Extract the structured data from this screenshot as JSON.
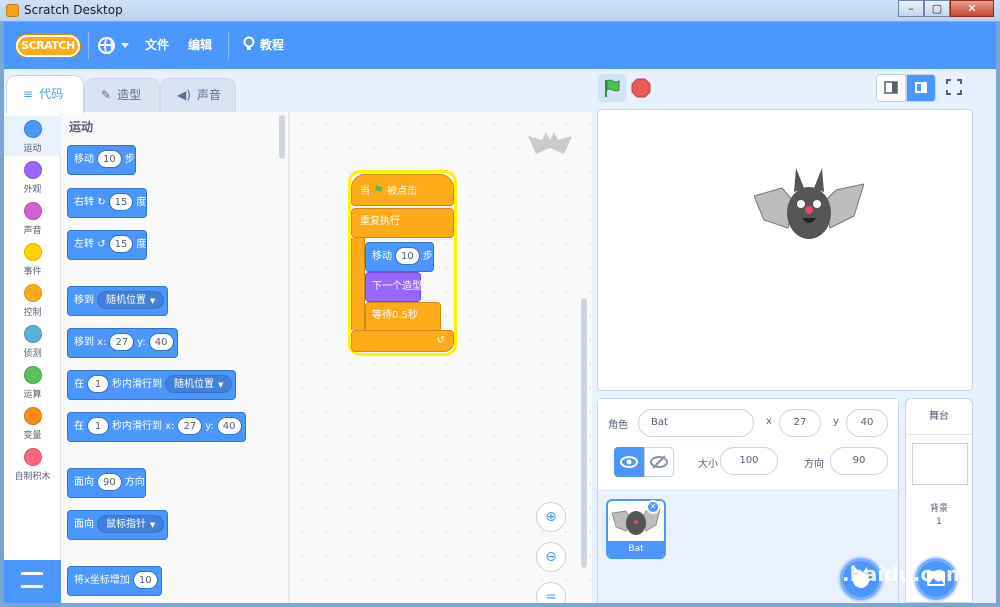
{
  "window": {
    "title": "Scratch Desktop",
    "controls": [
      "–",
      "▢",
      "✕"
    ]
  },
  "menubar": {
    "logo_text": "SCRATCH",
    "file_label": "文件",
    "edit_label": "编辑",
    "tutorials_label": "教程"
  },
  "tabs": {
    "code": "代码",
    "costumes": "造型",
    "sounds": "声音"
  },
  "categories": [
    {
      "label": "运动",
      "color": "#4c97ff"
    },
    {
      "label": "外观",
      "color": "#9966ff"
    },
    {
      "label": "声音",
      "color": "#cf63cf"
    },
    {
      "label": "事件",
      "color": "#ffd500"
    },
    {
      "label": "控制",
      "color": "#ffab19"
    },
    {
      "label": "侦测",
      "color": "#5cb1d6"
    },
    {
      "label": "运算",
      "color": "#59c059"
    },
    {
      "label": "变量",
      "color": "#ff8c1a"
    },
    {
      "label": "自制积木",
      "color": "#ff6680"
    }
  ],
  "palette": {
    "section_title": "运动",
    "move": {
      "a": "移动",
      "v": "10",
      "b": "步"
    },
    "turn_right": {
      "a": "右转",
      "v": "15",
      "b": "度"
    },
    "turn_left": {
      "a": "左转",
      "v": "15",
      "b": "度"
    },
    "goto": {
      "a": "移到",
      "d": "随机位置"
    },
    "goto_xy": {
      "a": "移到 x:",
      "x": "27",
      "b": "y:",
      "y": "40"
    },
    "glide": {
      "a": "在",
      "v": "1",
      "b": "秒内滑行到",
      "d": "随机位置"
    },
    "glide_xy": {
      "a": "在",
      "v": "1",
      "b": "秒内滑行到 x:",
      "x": "27",
      "c": "y:",
      "y": "40"
    },
    "point_dir": {
      "a": "面向",
      "v": "90",
      "b": "方向"
    },
    "point_towards": {
      "a": "面向",
      "d": "鼠标指针"
    },
    "change_x": {
      "a": "将x坐标增加",
      "v": "10"
    }
  },
  "script": {
    "hat": {
      "a": "当",
      "b": "被点击"
    },
    "forever": "重复执行",
    "move": {
      "a": "移动",
      "v": "10",
      "b": "步"
    },
    "next_costume": "下一个造型",
    "wait": {
      "a": "等待",
      "v": "0.5",
      "b": "秒"
    }
  },
  "sprite_info": {
    "sprite_label": "角色",
    "sprite_name": "Bat",
    "x_label": "x",
    "x_value": "27",
    "y_label": "y",
    "y_value": "40",
    "size_label": "大小",
    "size_value": "100",
    "direction_label": "方向",
    "direction_value": "90"
  },
  "sprite_list": [
    {
      "name": "Bat"
    }
  ],
  "stage_pane": {
    "title": "舞台",
    "backdrops_label": "背景",
    "backdrops_count": "1"
  },
  "watermark": ".baidu.com",
  "icons": [
    "globe-icon",
    "lightbulb-icon",
    "green-flag-icon",
    "stop-icon",
    "eye-icon",
    "eye-hidden-icon",
    "zoom-in-icon",
    "zoom-out-icon",
    "zoom-reset-icon",
    "fullscreen-icon"
  ]
}
